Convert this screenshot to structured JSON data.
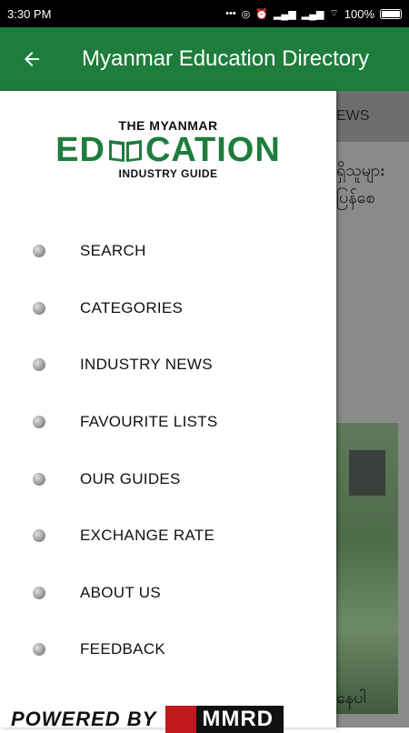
{
  "status_bar": {
    "time": "3:30 PM",
    "battery": "100%"
  },
  "app_bar": {
    "title": "Myanmar Education Directory"
  },
  "background": {
    "tab_label": "EWS",
    "text_line1": "ရှိသူများ",
    "text_line2": "ပြန်စေ",
    "bottom_text": "နေပါ"
  },
  "logo": {
    "top": "THE MYANMAR",
    "main_left": "ED",
    "main_right": "CATION",
    "sub": "INDUSTRY GUIDE"
  },
  "menu": [
    {
      "label": "SEARCH"
    },
    {
      "label": "CATEGORIES"
    },
    {
      "label": "INDUSTRY NEWS"
    },
    {
      "label": "FAVOURITE LISTS"
    },
    {
      "label": "OUR GUIDES"
    },
    {
      "label": "EXCHANGE RATE"
    },
    {
      "label": "ABOUT US"
    },
    {
      "label": "FEEDBACK"
    }
  ],
  "footer": {
    "powered_by": "POWERED BY",
    "brand": "MMRD"
  }
}
